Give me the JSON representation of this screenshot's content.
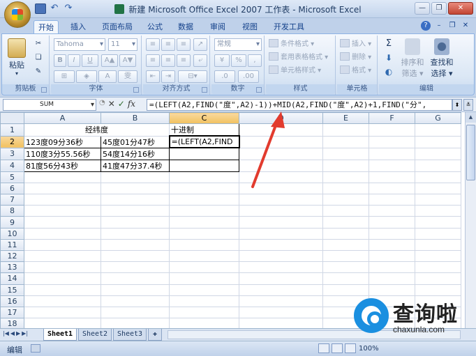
{
  "window": {
    "title": "新建 Microsoft Office Excel 2007 工作表 - Microsoft Excel"
  },
  "ribbon_tabs": [
    "开始",
    "插入",
    "页面布局",
    "公式",
    "数据",
    "审阅",
    "视图",
    "开发工具"
  ],
  "ribbon": {
    "clipboard": {
      "label": "剪贴板",
      "paste": "粘贴"
    },
    "font": {
      "label": "字体",
      "font_name": "Tahoma",
      "font_size": "11"
    },
    "alignment": {
      "label": "对齐方式"
    },
    "number": {
      "label": "数字",
      "format": "常规"
    },
    "styles": {
      "label": "样式",
      "conditional": "条件格式",
      "table": "套用表格格式",
      "cell": "单元格样式"
    },
    "cells": {
      "label": "单元格",
      "insert": "插入",
      "delete": "删除",
      "format": "格式"
    },
    "editing": {
      "label": "编辑",
      "sort": "排序和",
      "filter": "筛选",
      "find": "查找和",
      "select": "选择"
    }
  },
  "formula_bar": {
    "name_box": "SUM",
    "formula": "=(LEFT(A2,FIND(\"度\",A2)-1))+MID(A2,FIND(\"度\",A2)+1,FIND(\"分\","
  },
  "columns": [
    "A",
    "B",
    "C",
    "D",
    "E",
    "F",
    "G"
  ],
  "rows": [
    {
      "num": "1",
      "a": "经纬度",
      "b": "",
      "c": "十进制"
    },
    {
      "num": "2",
      "a": "123度09分36秒",
      "b": "45度01分47秒",
      "c": "=(LEFT(A2,FIND"
    },
    {
      "num": "3",
      "a": "110度3分55.56秒",
      "b": "54度14分16秒",
      "c": ""
    },
    {
      "num": "4",
      "a": "81度56分43秒",
      "b": "41度47分37.4秒",
      "c": ""
    },
    {
      "num": "5"
    },
    {
      "num": "6"
    },
    {
      "num": "7"
    },
    {
      "num": "8"
    },
    {
      "num": "9"
    },
    {
      "num": "10"
    },
    {
      "num": "11"
    },
    {
      "num": "12"
    },
    {
      "num": "13"
    },
    {
      "num": "14"
    },
    {
      "num": "15"
    },
    {
      "num": "16"
    },
    {
      "num": "17"
    },
    {
      "num": "18"
    }
  ],
  "sheets": [
    "Sheet1",
    "Sheet2",
    "Sheet3"
  ],
  "status": {
    "mode": "编辑",
    "zoom": "100%"
  },
  "watermark": {
    "brand": "查询啦",
    "url": "chaxunla.com"
  }
}
